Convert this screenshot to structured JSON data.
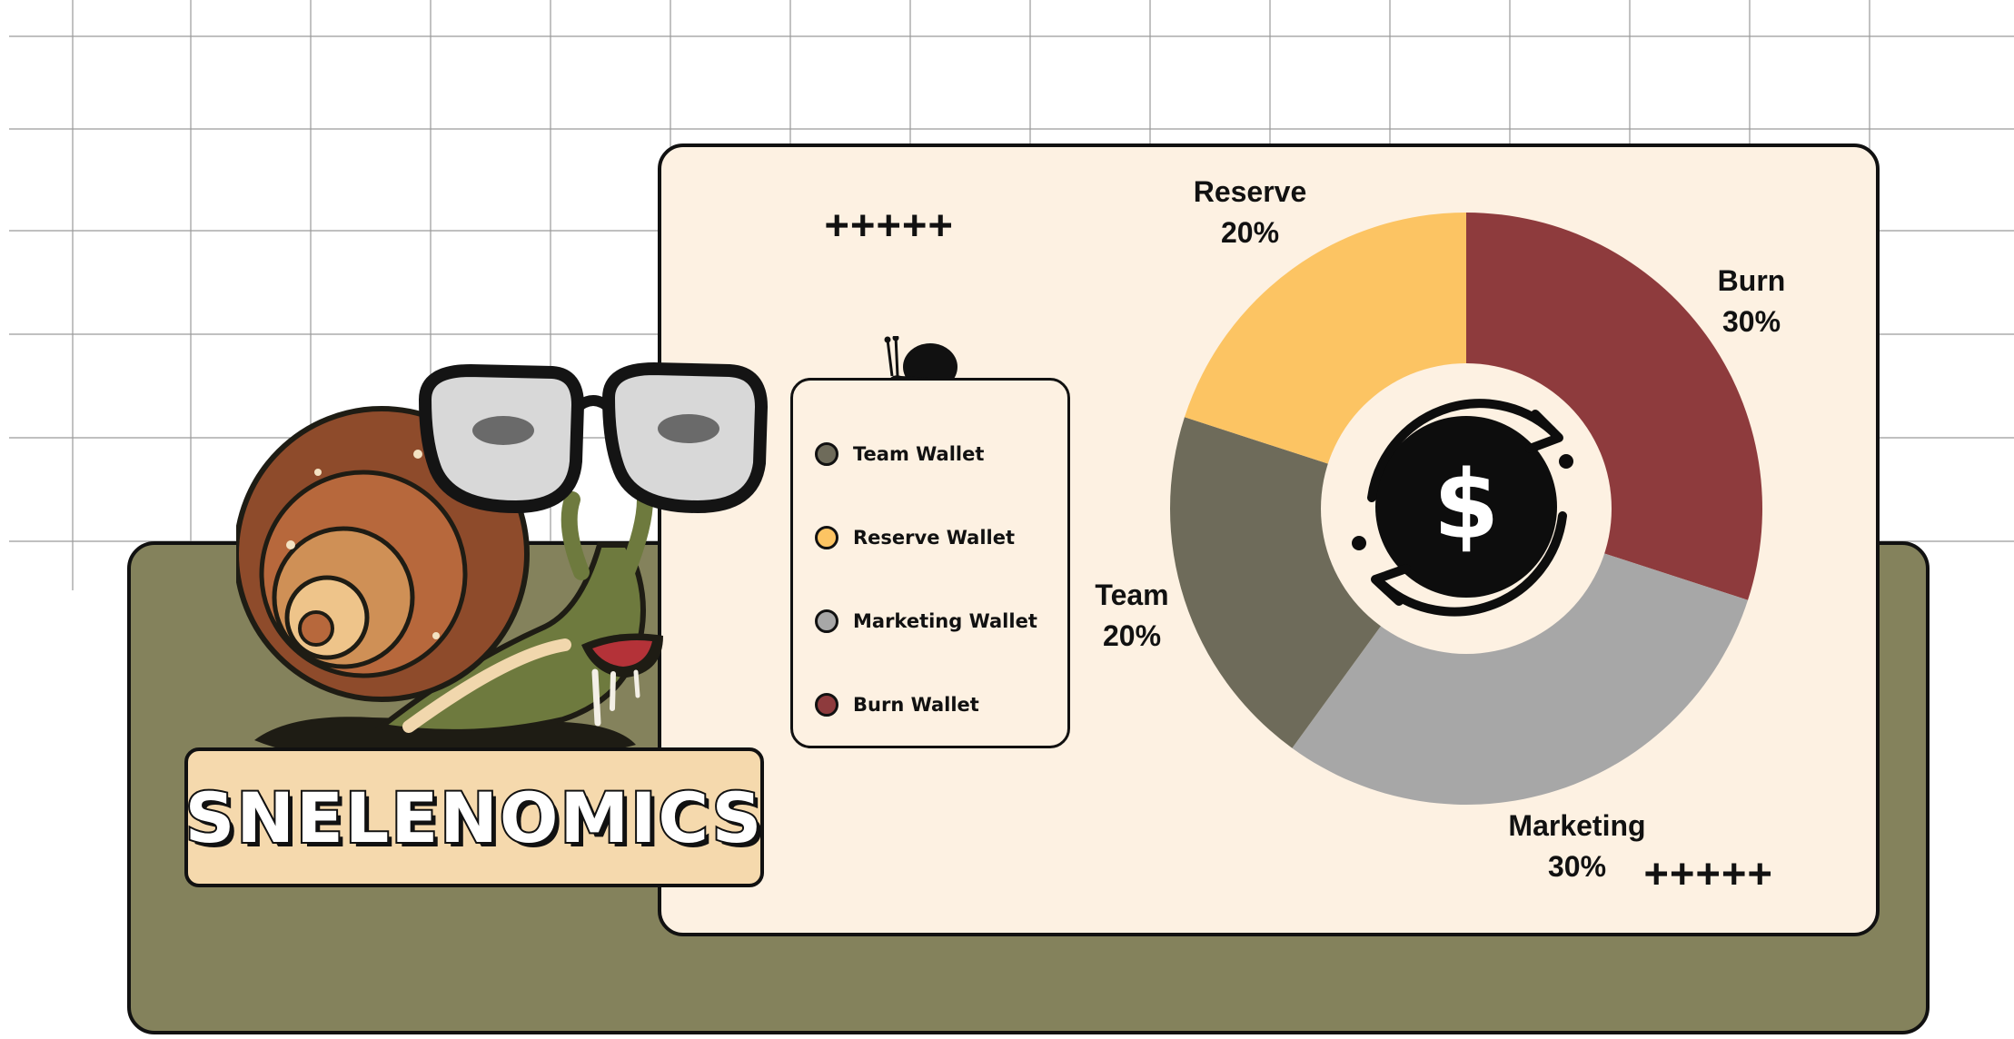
{
  "page": {
    "banner_title": "SNELENOMICS",
    "decor_plus_top": "+++++",
    "decor_plus_bottom": "+++++"
  },
  "legend": {
    "items": [
      {
        "label": "Team Wallet",
        "color": "#6e6b5a"
      },
      {
        "label": "Reserve Wallet",
        "color": "#fcc463"
      },
      {
        "label": "Marketing Wallet",
        "color": "#a7a7a7"
      },
      {
        "label": "Burn Wallet",
        "color": "#8e3b3d"
      }
    ]
  },
  "chart_data": {
    "type": "pie",
    "donut": true,
    "center_icon": "dollar-recycle-icon",
    "slices": [
      {
        "name": "Burn",
        "value": 30,
        "label": "30%",
        "color": "#8e3b3d"
      },
      {
        "name": "Marketing",
        "value": 30,
        "label": "30%",
        "color": "#a7a7a7"
      },
      {
        "name": "Team",
        "value": 20,
        "label": "20%",
        "color": "#6e6b5a"
      },
      {
        "name": "Reserve",
        "value": 20,
        "label": "20%",
        "color": "#fcc463"
      }
    ]
  },
  "colors": {
    "olive_panel": "#84825c",
    "cream_card": "#fdf1e2",
    "banner": "#f5d9ad",
    "outline": "#111111"
  }
}
